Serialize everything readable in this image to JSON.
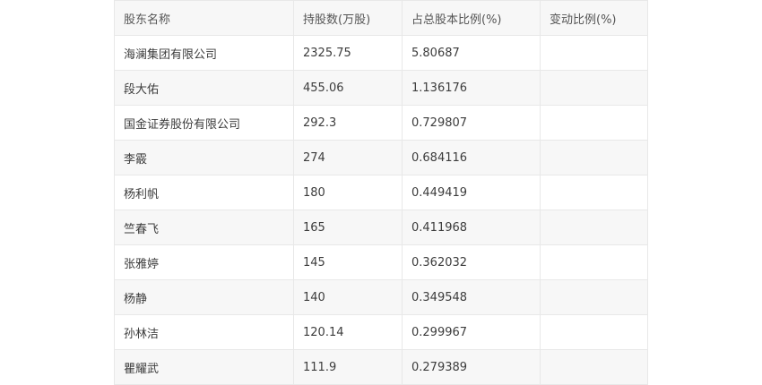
{
  "table": {
    "headers": [
      "股东名称",
      "持股数(万股)",
      "占总股本比例(%)",
      "变动比例(%)"
    ],
    "rows": [
      [
        "海澜集团有限公司",
        "2325.75",
        "5.80687",
        ""
      ],
      [
        "段大佑",
        "455.06",
        "1.136176",
        ""
      ],
      [
        "国金证券股份有限公司",
        "292.3",
        "0.729807",
        ""
      ],
      [
        "李霰",
        "274",
        "0.684116",
        ""
      ],
      [
        "杨利帆",
        "180",
        "0.449419",
        ""
      ],
      [
        "竺春飞",
        "165",
        "0.411968",
        ""
      ],
      [
        "张雅婷",
        "145",
        "0.362032",
        ""
      ],
      [
        "杨静",
        "140",
        "0.349548",
        ""
      ],
      [
        "孙林洁",
        "120.14",
        "0.299967",
        ""
      ],
      [
        "瞿耀武",
        "111.9",
        "0.279389",
        ""
      ]
    ]
  },
  "colors": {
    "border": "#e8e8e8",
    "stripe": "#f7f7f7",
    "text": "#3c3c3c"
  }
}
